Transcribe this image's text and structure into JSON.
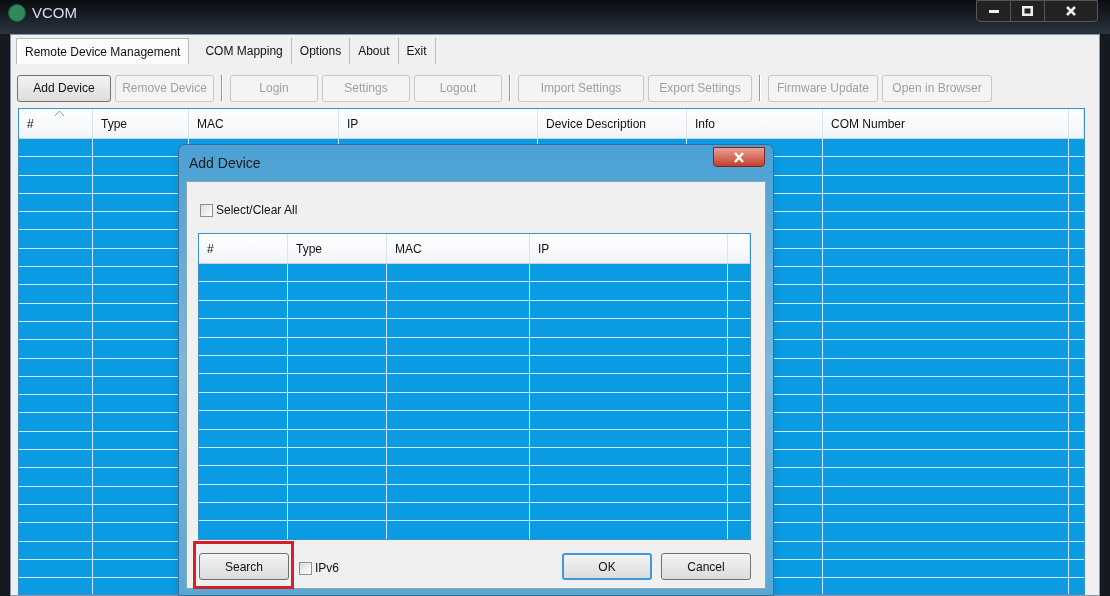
{
  "window": {
    "title": "VCOM"
  },
  "tabs": [
    {
      "label": "Remote Device Management",
      "selected": true
    },
    {
      "label": "COM Mapping",
      "selected": false
    },
    {
      "label": "Options",
      "selected": false
    },
    {
      "label": "About",
      "selected": false
    },
    {
      "label": "Exit",
      "selected": false
    }
  ],
  "toolbar": [
    {
      "label": "Add Device",
      "disabled": false,
      "group_start": false
    },
    {
      "label": "Remove Device",
      "disabled": true,
      "group_start": false
    },
    {
      "label": "Login",
      "disabled": true,
      "group_start": true
    },
    {
      "label": "Settings",
      "disabled": true,
      "group_start": false
    },
    {
      "label": "Logout",
      "disabled": true,
      "group_start": false
    },
    {
      "label": "Import Settings",
      "disabled": true,
      "group_start": true
    },
    {
      "label": "Export Settings",
      "disabled": true,
      "group_start": false
    },
    {
      "label": "Firmware Update",
      "disabled": true,
      "group_start": true
    },
    {
      "label": "Open in Browser",
      "disabled": true,
      "group_start": false
    }
  ],
  "table": {
    "columns": [
      "#",
      "Type",
      "MAC",
      "IP",
      "Device Description",
      "Info",
      "COM Number"
    ]
  },
  "dialog": {
    "title": "Add Device",
    "select_all": {
      "label": "Select/Clear All",
      "checked": false
    },
    "table": {
      "columns": [
        "#",
        "Type",
        "MAC",
        "IP"
      ]
    },
    "search_button": {
      "label": "Search",
      "highlighted": true
    },
    "ipv6": {
      "label": "IPv6",
      "checked": false
    },
    "buttons": [
      {
        "label": "OK",
        "default": true
      },
      {
        "label": "Cancel",
        "default": false
      }
    ]
  }
}
